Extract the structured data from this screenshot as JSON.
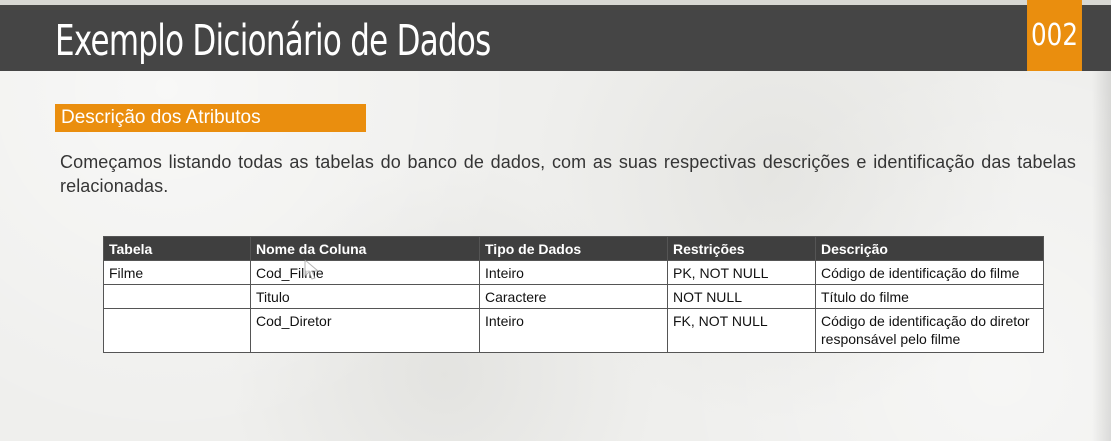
{
  "header": {
    "title": "Exemplo Dicionário de Dados",
    "slide_number": "002"
  },
  "section": {
    "label": "Descrição dos Atributos"
  },
  "intro": {
    "text": "Começamos listando todas as tabelas do banco de dados, com as suas respectivas descrições e identificação das tabelas relacionadas."
  },
  "table": {
    "columns": [
      "Tabela",
      "Nome da Coluna",
      "Tipo de Dados",
      "Restrições",
      "Descrição"
    ],
    "rows": [
      [
        "Filme",
        "Cod_Filme",
        "Inteiro",
        "PK, NOT NULL",
        "Código de identificação do filme"
      ],
      [
        "",
        "Titulo",
        "Caractere",
        "NOT NULL",
        "Título do filme"
      ],
      [
        "",
        "Cod_Diretor",
        "Inteiro",
        "FK, NOT NULL",
        "Código de identificação do diretor responsável pelo filme"
      ]
    ]
  },
  "colors": {
    "accent": "#ea8e0e",
    "header_bar": "#454545",
    "table_header": "#3f3f3f"
  },
  "icons": {
    "cursor": "mouse-pointer-icon"
  }
}
